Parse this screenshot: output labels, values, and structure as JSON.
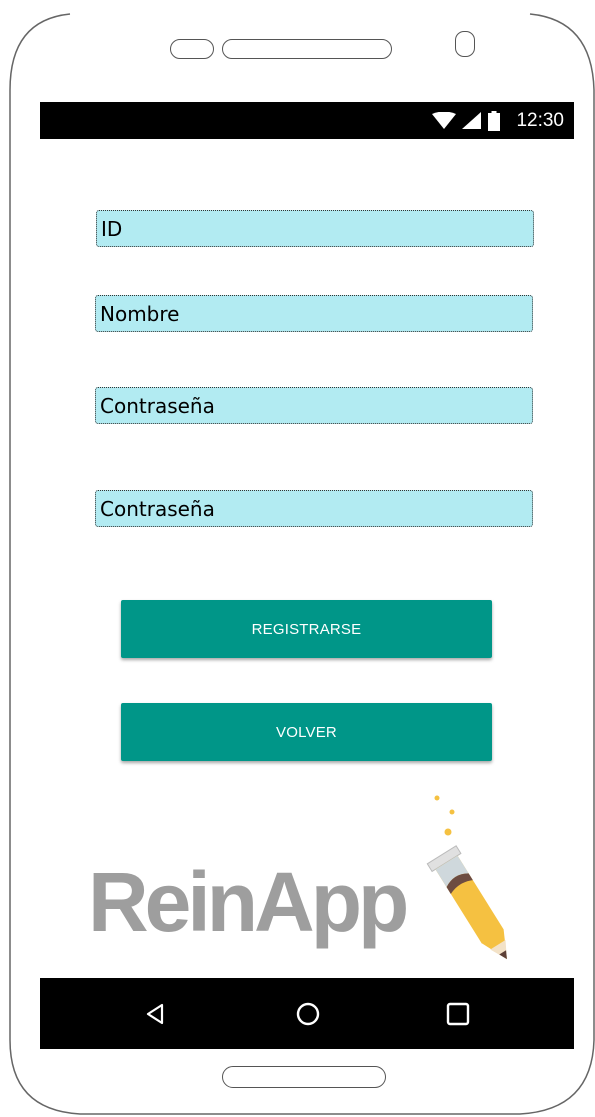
{
  "status_bar": {
    "time": "12:30",
    "icons": [
      "wifi-icon",
      "signal-icon",
      "battery-icon"
    ]
  },
  "form": {
    "id_field": "ID",
    "name_field": "Nombre",
    "password_field": "Contraseña",
    "confirm_password_field": "Contraseña"
  },
  "buttons": {
    "register_label": "REGISTRARSE",
    "back_label": "VOLVER"
  },
  "logo": {
    "text": "ReinApp"
  },
  "nav_bar": {
    "icons": [
      "back-triangle-icon",
      "home-circle-icon",
      "recents-square-icon"
    ]
  },
  "colors": {
    "field_background": "#b2ebf2",
    "button_background": "#009688",
    "logo_text": "#9e9e9e",
    "bar_background": "#000000"
  }
}
